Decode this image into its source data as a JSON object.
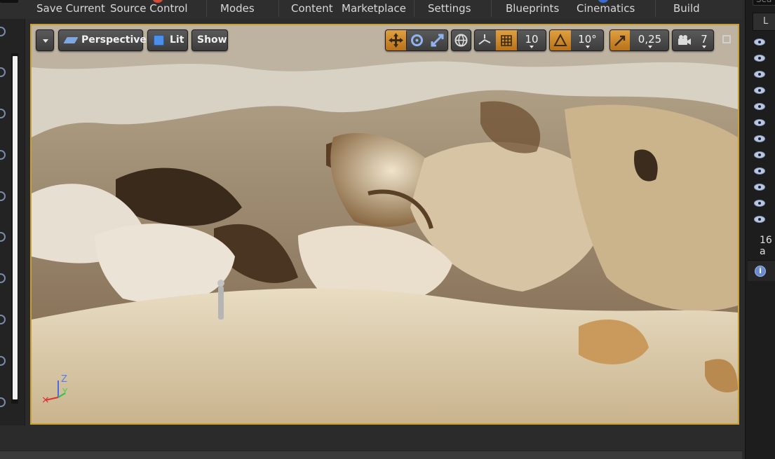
{
  "toolbar": {
    "save_current": "Save Current",
    "source_control": "Source Control",
    "modes": "Modes",
    "content": "Content",
    "marketplace": "Marketplace",
    "settings": "Settings",
    "blueprints": "Blueprints",
    "cinematics": "Cinematics",
    "build": "Build"
  },
  "viewport": {
    "options_icon": "chevron-down-icon",
    "perspective_label": "Perspective",
    "lit_label": "Lit",
    "show_label": "Show",
    "grid_snap_value": "10",
    "rotation_snap_value": "10°",
    "scale_snap_value": "0,25",
    "camera_speed_value": "7",
    "axis_labels": {
      "z": "Z",
      "y": "Y"
    }
  },
  "outliner": {
    "search_placeholder": "Sea",
    "header_label": "L",
    "actor_count": "16 a",
    "details_icon": "info-icon"
  },
  "colors": {
    "viewport_border": "#c8a032",
    "snap_active": "#d89433",
    "eye_icon": "#b9c7e3"
  }
}
